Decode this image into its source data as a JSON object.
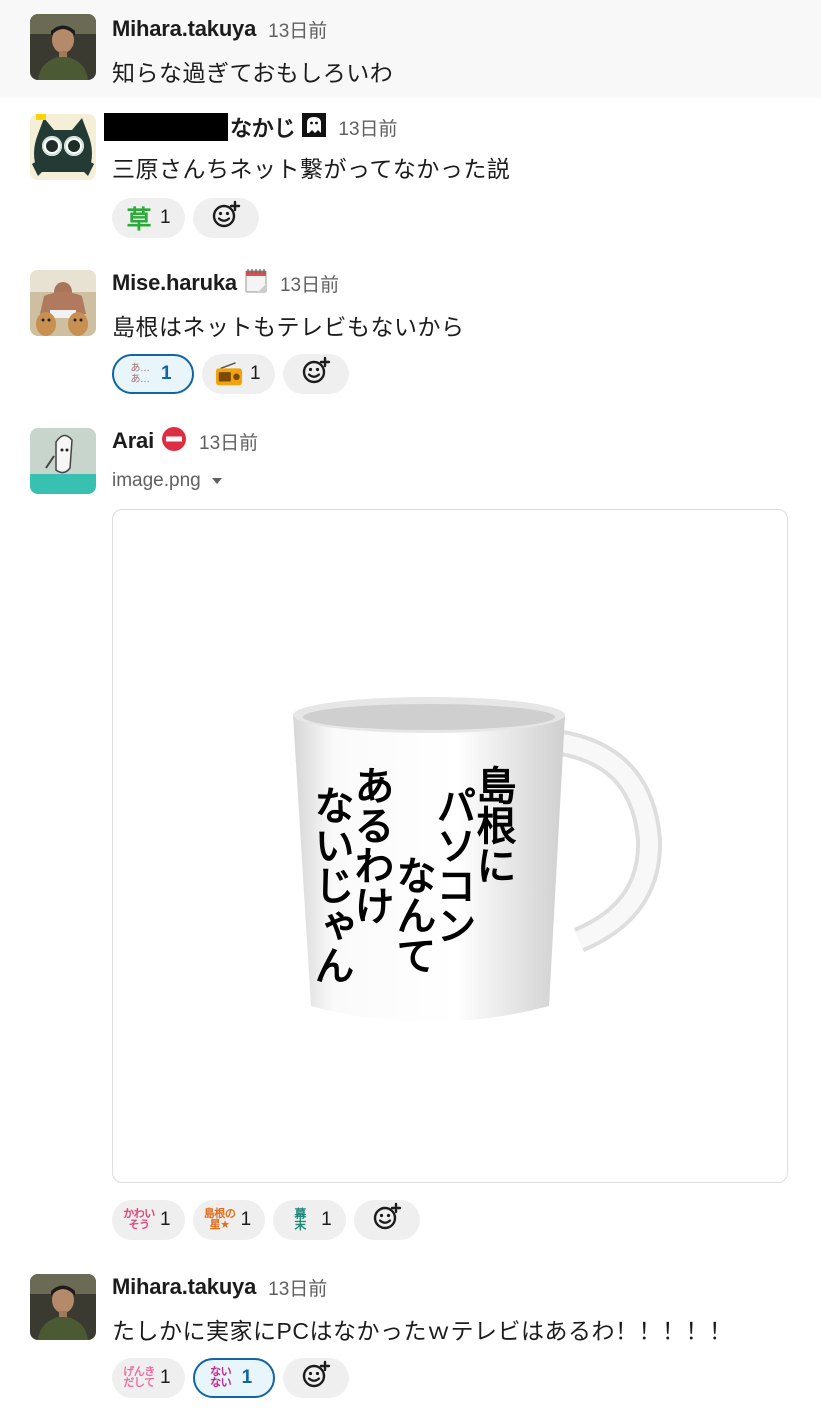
{
  "messages": [
    {
      "name": "Mihara.takuya",
      "time": "13日前",
      "text": "知らな過ぎておもしろいわ"
    },
    {
      "name": "なかじ",
      "time": "13日前",
      "text": "三原さんちネット繋がってなかった説",
      "reactions": [
        {
          "emoji": "草",
          "count": "1"
        }
      ]
    },
    {
      "name": "Mise.haruka",
      "time": "13日前",
      "text": "島根はネットもテレビもないから",
      "reactions": [
        {
          "emoji_text": "あ…\nあ…",
          "count": "1"
        },
        {
          "emoji": "radio-emoji",
          "count": "1"
        }
      ]
    },
    {
      "name": "Arai",
      "time": "13日前",
      "file": "image.png",
      "image_text": [
        "島根に",
        "パソコン",
        "なんて",
        "あるわけ",
        "ないじゃん"
      ],
      "reactions": [
        {
          "emoji_text": "かわい\nそう",
          "count": "1"
        },
        {
          "emoji_text": "島根の\n星★",
          "count": "1"
        },
        {
          "emoji_text": "幕\n末",
          "count": "1"
        }
      ]
    },
    {
      "name": "Mihara.takuya",
      "time": "13日前",
      "text": "たしかに実家にPCはなかったｗテレビはあるわ！！！！！",
      "reactions": [
        {
          "emoji_text": "げんき\nだして",
          "count": "1"
        },
        {
          "emoji_text": "ない\nない",
          "count": "1"
        }
      ]
    }
  ],
  "colors": {
    "text": "#1d1c1d",
    "muted": "#616061",
    "reaction_bg": "#efefef",
    "reaction_mine_bg": "#e8f5fa",
    "reaction_mine_border": "#1264a3",
    "highlight_bg": "#f8f8f8"
  }
}
